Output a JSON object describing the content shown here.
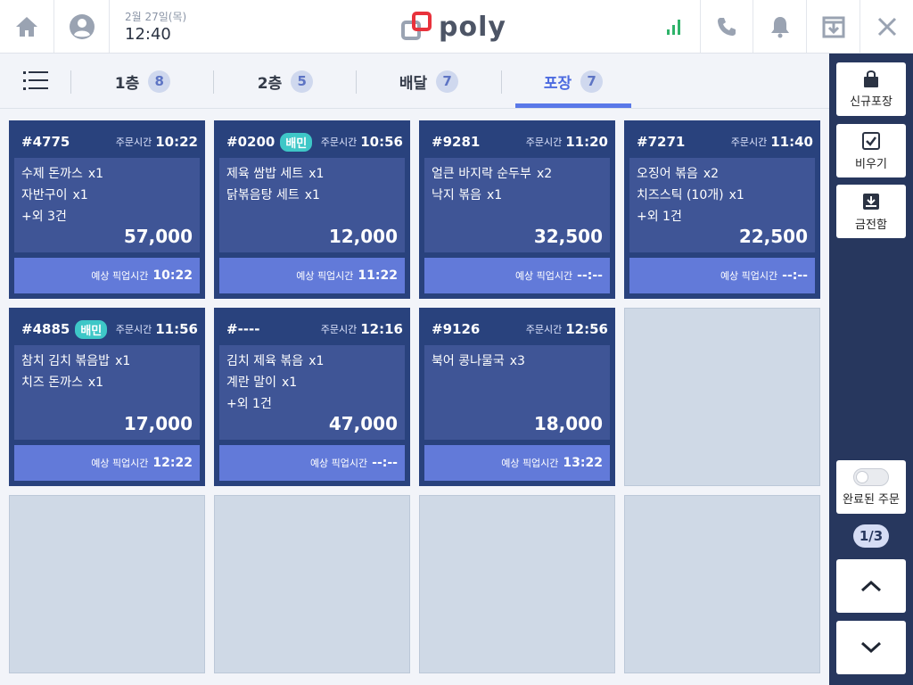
{
  "header": {
    "date": "2월 27일(목)",
    "time": "12:40",
    "logo_text": "poly"
  },
  "tabs": [
    {
      "label": "1층",
      "count": "8"
    },
    {
      "label": "2층",
      "count": "5"
    },
    {
      "label": "배달",
      "count": "7"
    },
    {
      "label": "포장",
      "count": "7"
    }
  ],
  "card_labels": {
    "order_time": "주문시간",
    "pickup_time": "예상 픽업시간"
  },
  "orders": [
    {
      "no": "#4775",
      "badge": "",
      "order_time": "10:22",
      "items": [
        {
          "name": "수제 돈까스",
          "qty": "x1"
        },
        {
          "name": "자반구이",
          "qty": "x1"
        },
        {
          "name": "+외 3건",
          "qty": ""
        }
      ],
      "price": "57,000",
      "pickup": "10:22"
    },
    {
      "no": "#0200",
      "badge": "배민",
      "order_time": "10:56",
      "items": [
        {
          "name": "제육 쌈밥 세트",
          "qty": "x1"
        },
        {
          "name": "닭볶음탕 세트",
          "qty": "x1"
        },
        {
          "name": "",
          "qty": ""
        }
      ],
      "price": "12,000",
      "pickup": "11:22"
    },
    {
      "no": "#9281",
      "badge": "",
      "order_time": "11:20",
      "items": [
        {
          "name": "얼큰 바지락 순두부",
          "qty": "x2"
        },
        {
          "name": "낙지 볶음",
          "qty": "x1"
        },
        {
          "name": "",
          "qty": ""
        }
      ],
      "price": "32,500",
      "pickup": "--:--"
    },
    {
      "no": "#7271",
      "badge": "",
      "order_time": "11:40",
      "items": [
        {
          "name": "오징어 볶음",
          "qty": "x2"
        },
        {
          "name": "치즈스틱 (10개)",
          "qty": "x1"
        },
        {
          "name": "+외 1건",
          "qty": ""
        }
      ],
      "price": "22,500",
      "pickup": "--:--"
    },
    {
      "no": "#4885",
      "badge": "배민",
      "order_time": "11:56",
      "items": [
        {
          "name": "참치 김치 볶음밥",
          "qty": "x1"
        },
        {
          "name": "치즈 돈까스",
          "qty": "x1"
        },
        {
          "name": "",
          "qty": ""
        }
      ],
      "price": "17,000",
      "pickup": "12:22"
    },
    {
      "no": "#----",
      "badge": "",
      "order_time": "12:16",
      "items": [
        {
          "name": "김치 제육 볶음",
          "qty": "x1"
        },
        {
          "name": "계란 말이",
          "qty": "x1"
        },
        {
          "name": "+외 1건",
          "qty": ""
        }
      ],
      "price": "47,000",
      "pickup": "--:--"
    },
    {
      "no": "#9126",
      "badge": "",
      "order_time": "12:56",
      "items": [
        {
          "name": "북어 콩나물국",
          "qty": "x3"
        },
        {
          "name": "",
          "qty": ""
        },
        {
          "name": "",
          "qty": ""
        }
      ],
      "price": "18,000",
      "pickup": "13:22"
    }
  ],
  "sidebar": {
    "new_pack": "신규포장",
    "clear": "비우기",
    "cash_drawer": "금전함",
    "completed_orders": "완료된 주문",
    "page": "1/3"
  },
  "colors": {
    "accent": "#5a78e8",
    "card_dark": "#29427d",
    "card_mid": "#3f5596",
    "card_foot": "#627ad9",
    "badge_bm": "#3ec7c7",
    "sidebar": "#27375e",
    "signal": "#2fb36a",
    "logo_red": "#e8323c"
  }
}
